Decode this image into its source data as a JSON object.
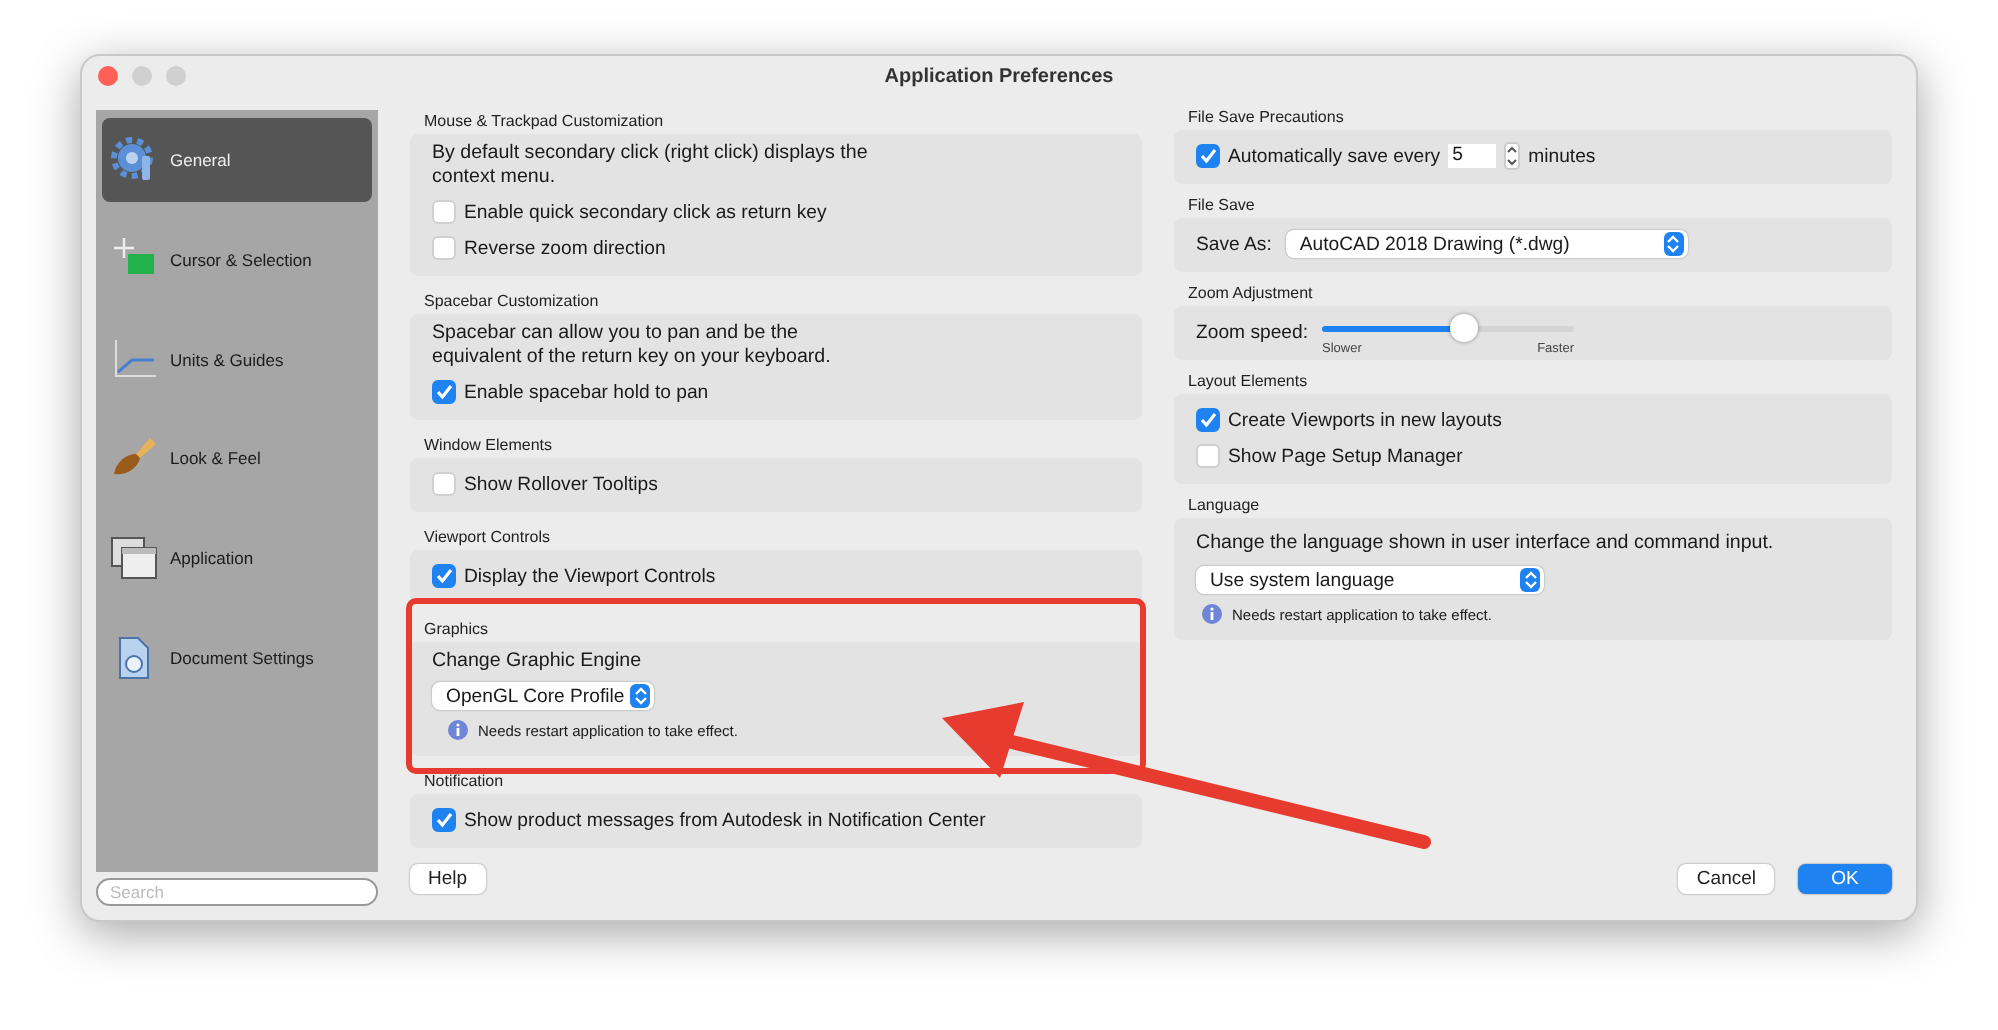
{
  "window": {
    "title": "Application Preferences"
  },
  "sidebar": {
    "items": [
      {
        "label": "General",
        "selected": true
      },
      {
        "label": "Cursor & Selection",
        "selected": false
      },
      {
        "label": "Units & Guides",
        "selected": false
      },
      {
        "label": "Look & Feel",
        "selected": false
      },
      {
        "label": "Application",
        "selected": false
      },
      {
        "label": "Document Settings",
        "selected": false
      }
    ],
    "search": {
      "placeholder": "Search"
    }
  },
  "left_sections": [
    {
      "title": "Mouse & Trackpad Customization",
      "items": [
        {
          "kind": "text",
          "text": "By default secondary click (right click) displays the context menu."
        },
        {
          "kind": "checkbox",
          "label": "Enable quick secondary click as return key",
          "checked": false
        },
        {
          "kind": "checkbox",
          "label": "Reverse zoom direction",
          "checked": false
        }
      ]
    },
    {
      "title": "Spacebar Customization",
      "items": [
        {
          "kind": "text",
          "text": "Spacebar can allow you to pan and be the equivalent of the return key on your keyboard."
        },
        {
          "kind": "checkbox",
          "label": "Enable spacebar hold to pan",
          "checked": true
        }
      ]
    },
    {
      "title": "Window Elements",
      "items": [
        {
          "kind": "checkbox",
          "label": "Show Rollover Tooltips",
          "checked": false
        }
      ]
    },
    {
      "title": "Viewport Controls",
      "items": [
        {
          "kind": "checkbox",
          "label": "Display the Viewport Controls",
          "checked": true
        }
      ]
    },
    {
      "title": "Graphics",
      "items": [
        {
          "kind": "text",
          "text": "Change Graphic Engine"
        },
        {
          "kind": "select",
          "value": "OpenGL Core Profile"
        },
        {
          "kind": "info",
          "text": "Needs restart application to take effect."
        }
      ]
    },
    {
      "title": "Notification",
      "items": [
        {
          "kind": "checkbox",
          "label": "Show product messages from Autodesk in Notification Center",
          "checked": true
        }
      ]
    }
  ],
  "right_sections": [
    {
      "title": "File Save Precautions",
      "items": [
        {
          "kind": "autosave",
          "label": "Automatically save every",
          "value": "5",
          "unit": "minutes",
          "checked": true
        }
      ]
    },
    {
      "title": "File Save",
      "items": [
        {
          "kind": "select",
          "label": "Save As:",
          "value": "AutoCAD 2018 Drawing (*.dwg)"
        }
      ]
    },
    {
      "title": "Zoom Adjustment",
      "items": [
        {
          "kind": "slider",
          "label": "Zoom speed:",
          "min_label": "Slower",
          "max_label": "Faster",
          "level": 0.57
        }
      ]
    },
    {
      "title": "Layout Elements",
      "items": [
        {
          "kind": "checkbox",
          "label": "Create Viewports in new layouts",
          "checked": true
        },
        {
          "kind": "checkbox",
          "label": "Show Page Setup Manager",
          "checked": false
        }
      ]
    },
    {
      "title": "Language",
      "items": [
        {
          "kind": "text",
          "text": "Change the language shown in user interface and command input."
        },
        {
          "kind": "select",
          "value": "Use system language"
        },
        {
          "kind": "info",
          "text": "Needs restart application to take effect."
        }
      ]
    }
  ],
  "buttons": {
    "help": "Help",
    "cancel": "Cancel",
    "ok": "OK"
  }
}
